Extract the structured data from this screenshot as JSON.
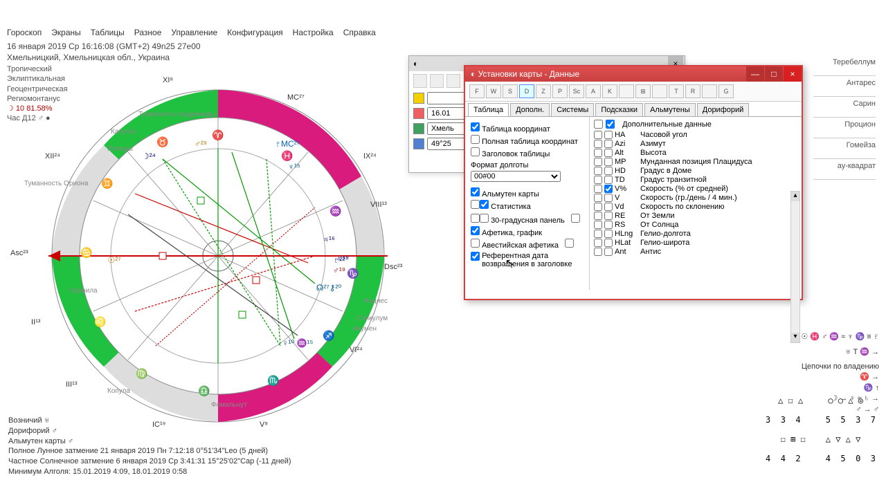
{
  "menu": [
    "Гороскоп",
    "Экраны",
    "Таблицы",
    "Разное",
    "Управление",
    "Конфигурация",
    "Настройка",
    "Справка"
  ],
  "header": {
    "line1": "16 января 2019  Ср  16:16:08 (GMT+2) 49n25  27e00",
    "line2": "Хмельницкий, Хмельницкая обл., Украина"
  },
  "side": {
    "l1": "Тропический",
    "l2": "Эклиптикальная",
    "l3": "Геоцентрическая",
    "l4": "Региомонтанус",
    "l5": "☽ 10 81.58%",
    "l6": "Час Д12 ♂ ●"
  },
  "stars_right": [
    "Теребеллум",
    "Антарес",
    "Сарин",
    "Процион",
    "Гомейза",
    "ау-квадрат"
  ],
  "bottom": {
    "l1": "Возничий  ♅",
    "l2": "Дорифорий  ♂",
    "l3": "Альмутен карты  ♂",
    "l4": "Полное Лунное затмение 21 января 2019 Пн  7:12:18  0°51'34\"Leo (5 дней)",
    "l5": "Частное Солнечное затмение 6 января 2019 Ср  3:41:31  15°25'02\"Cap (-11 дней)",
    "l6": "Минимум Алголя: 15.01.2019  4:09,  18.01.2019  0:58"
  },
  "chains": {
    "line1": "☉ ♓ ♂ ♒ ≈ ♆ ♑ ≡ ♇",
    "line2": "♅ Т ♒ →",
    "title": "Цепочки по владению",
    "r1": "♈ →",
    "r2": "♑ ↑",
    "r3": "☽ → ♀ ≈ ♄ →",
    "r4": "♂ → ♂"
  },
  "glyphs": {
    "row1": "△ ☐ △     ○ ○ △ ◎",
    "row2": "3  3  4     5  5  3  7",
    "row3": "☐ ⊞ ☐    △ ▽ △ ▽",
    "row4": "4  4  2     4  5  0  3"
  },
  "bgwin": {
    "title": "",
    "date": "16.01",
    "loc": "Хмель",
    "coord": "49°25"
  },
  "settings": {
    "title": "Установки карты - Данные",
    "tabs": [
      "Таблица",
      "Дополн.",
      "Системы",
      "Подсказки",
      "Альмутены",
      "Дорифорий"
    ],
    "left": {
      "t1": "Таблица координат",
      "t2": "Полная таблица координат",
      "t3": "Заголовок таблицы",
      "fmt_label": "Формат долготы",
      "fmt_value": "00#00",
      "t4": "Альмутен карты",
      "t5": "Статистика",
      "t6": "30-градусная панель",
      "t7": "Афетика, график",
      "t8": "Авестийская афетика",
      "t9": "Референтная дата возвращения в заголовке"
    },
    "right_header": "Дополнительные данные",
    "right_items": [
      {
        "code": "HA",
        "label": "Часовой угол",
        "chk": false
      },
      {
        "code": "Azi",
        "label": "Азимут",
        "chk": false
      },
      {
        "code": "Alt",
        "label": "Высота",
        "chk": false
      },
      {
        "code": "MP",
        "label": "Мунданная позиция Плацидуса",
        "chk": false
      },
      {
        "code": "HD",
        "label": "Градус в Доме",
        "chk": false
      },
      {
        "code": "TD",
        "label": "Градус транзитной",
        "chk": false
      },
      {
        "code": "V%",
        "label": "Скорость (% от средней)",
        "chk": true
      },
      {
        "code": "V",
        "label": "Скорость (гр./день / 4 мин.)",
        "chk": false
      },
      {
        "code": "Vd",
        "label": "Скорость по склонению",
        "chk": false
      },
      {
        "code": "RE",
        "label": "От Земли",
        "chk": false
      },
      {
        "code": "RS",
        "label": "От Солнца",
        "chk": false
      },
      {
        "code": "HLng",
        "label": "Гелио-долгота",
        "chk": false
      },
      {
        "code": "HLat",
        "label": "Гелио-широта",
        "chk": false
      },
      {
        "code": "Ant",
        "label": "Антис",
        "chk": false
      }
    ]
  },
  "houses": [
    "Asc²³",
    "II¹³",
    "III¹³",
    "IC¹⁹",
    "V⁸",
    "VI²⁴",
    "Dsc²³",
    "VIII¹³",
    "IX²⁴",
    "MC²⁷",
    "XI⁸",
    "XII²⁴"
  ],
  "star_labels": [
    "Туманность Ориона",
    "Плеяды",
    "Капулус",
    "Туманность Андромеды",
    "Правила",
    "Копула",
    "Фомальнут",
    "Фациес",
    "Спикулум",
    "Акумен"
  ]
}
